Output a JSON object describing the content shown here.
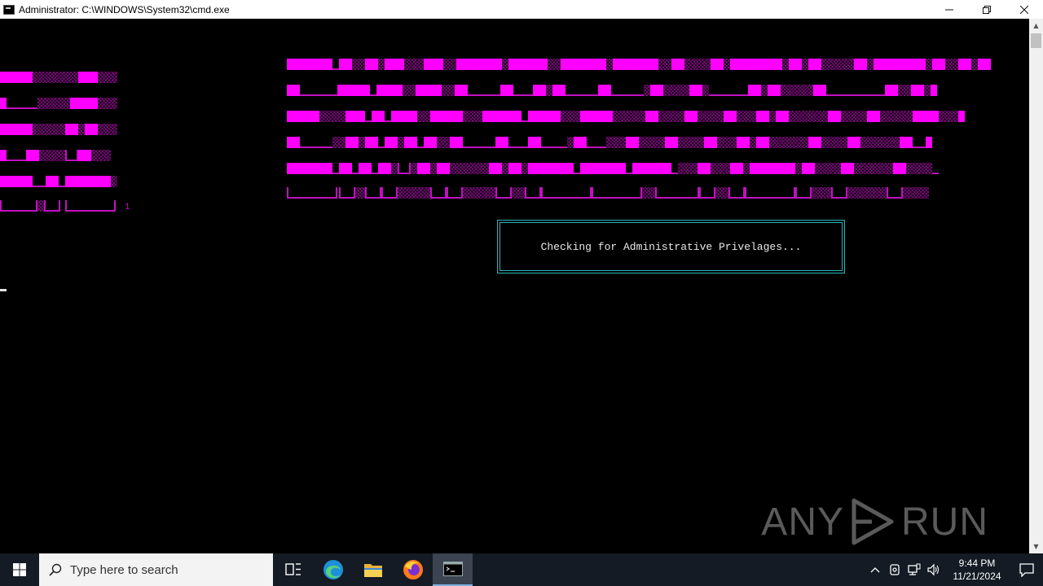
{
  "window": {
    "title": "Administrator: C:\\WINDOWS\\System32\\cmd.exe",
    "minimize_icon": "minimize-icon",
    "maximize_icon": "restore-icon",
    "close_icon": "close-icon"
  },
  "console": {
    "banner_number": "1",
    "message": "Checking for Administrative Privelages...",
    "colors": {
      "banner": "#ff00ff",
      "box_border": "#2bb5bb",
      "text": "#e8e8e8"
    }
  },
  "watermark": {
    "left": "ANY",
    "right": "RUN"
  },
  "taskbar": {
    "search_placeholder": "Type here to search",
    "icons": [
      "windows-start-icon",
      "task-view-icon",
      "edge-icon",
      "file-explorer-icon",
      "firefox-icon",
      "cmd-icon"
    ],
    "time": "9:44 PM",
    "date": "11/21/2024"
  }
}
